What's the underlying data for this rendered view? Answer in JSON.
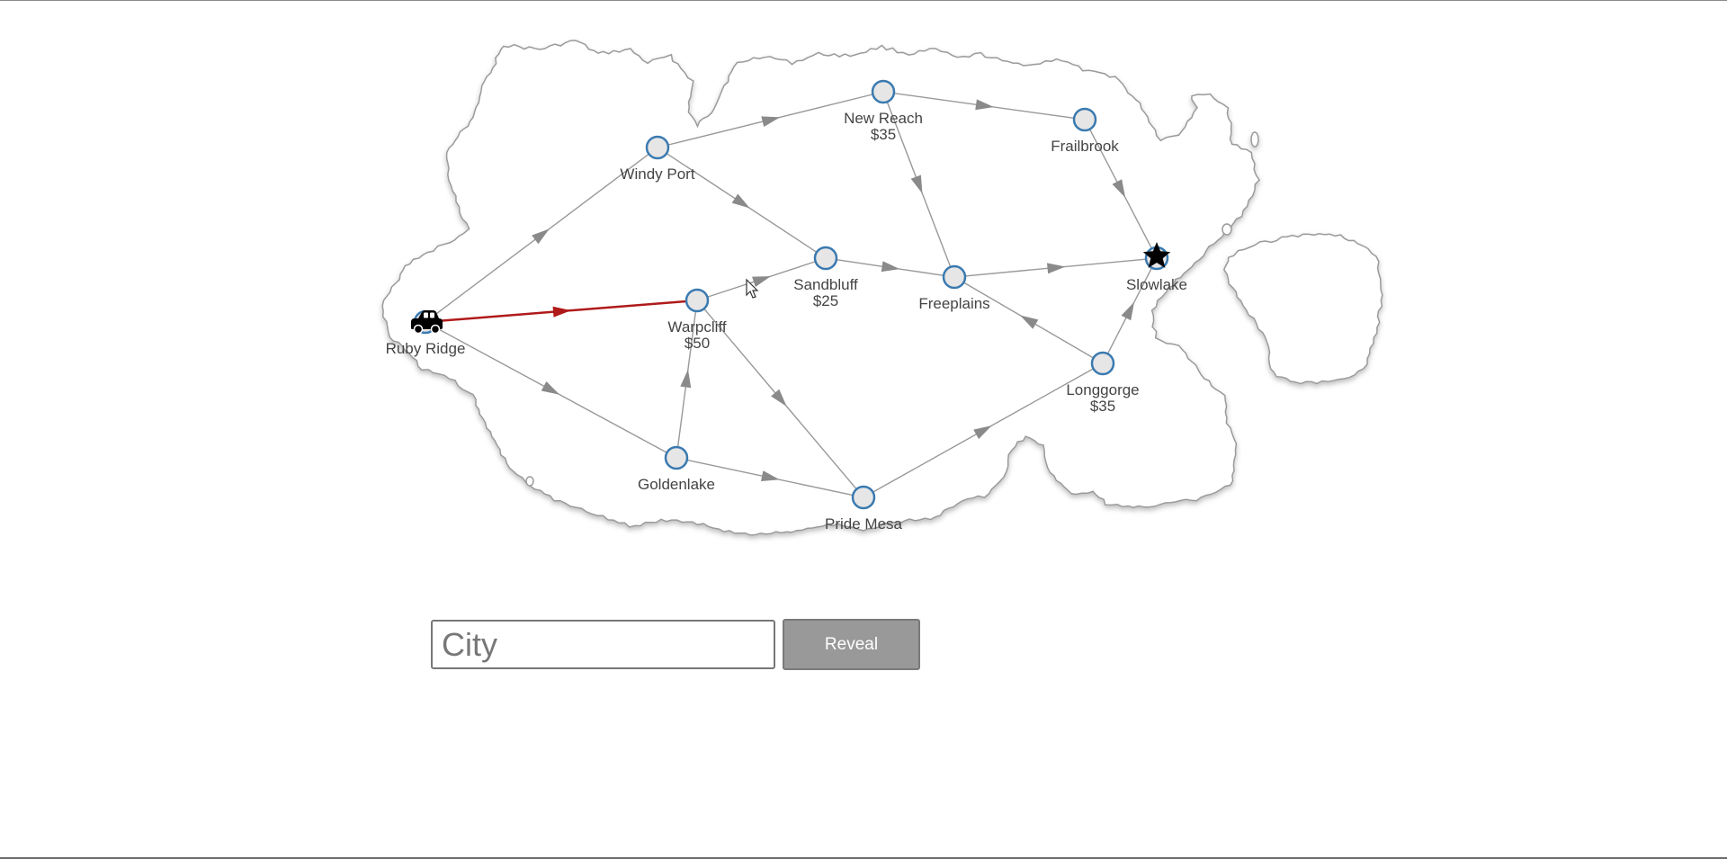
{
  "map": {
    "cities": [
      {
        "id": "ruby-ridge",
        "name": "Ruby Ridge",
        "cost": "",
        "marker": "car-icon"
      },
      {
        "id": "windy-port",
        "name": "Windy Port",
        "cost": ""
      },
      {
        "id": "new-reach",
        "name": "New Reach",
        "cost": "$35"
      },
      {
        "id": "frailbrook",
        "name": "Frailbrook",
        "cost": ""
      },
      {
        "id": "sandbluff",
        "name": "Sandbluff",
        "cost": "$25"
      },
      {
        "id": "warpcliff",
        "name": "Warpcliff",
        "cost": "$50"
      },
      {
        "id": "freeplains",
        "name": "Freeplains",
        "cost": ""
      },
      {
        "id": "slowlake",
        "name": "Slowlake",
        "cost": "",
        "marker": "star-icon"
      },
      {
        "id": "longgorge",
        "name": "Longgorge",
        "cost": "$35"
      },
      {
        "id": "goldenlake",
        "name": "Goldenlake",
        "cost": ""
      },
      {
        "id": "pride-mesa",
        "name": "Pride Mesa",
        "cost": ""
      }
    ],
    "roads": [
      {
        "from": "ruby-ridge",
        "to": "windy-port"
      },
      {
        "from": "ruby-ridge",
        "to": "warpcliff",
        "highlighted": true
      },
      {
        "from": "ruby-ridge",
        "to": "goldenlake"
      },
      {
        "from": "windy-port",
        "to": "new-reach"
      },
      {
        "from": "windy-port",
        "to": "sandbluff"
      },
      {
        "from": "new-reach",
        "to": "frailbrook"
      },
      {
        "from": "new-reach",
        "to": "freeplains"
      },
      {
        "from": "frailbrook",
        "to": "slowlake"
      },
      {
        "from": "warpcliff",
        "to": "sandbluff"
      },
      {
        "from": "sandbluff",
        "to": "freeplains"
      },
      {
        "from": "freeplains",
        "to": "slowlake"
      },
      {
        "from": "warpcliff",
        "to": "pride-mesa"
      },
      {
        "from": "goldenlake",
        "to": "warpcliff"
      },
      {
        "from": "goldenlake",
        "to": "pride-mesa"
      },
      {
        "from": "pride-mesa",
        "to": "longgorge"
      },
      {
        "from": "longgorge",
        "to": "freeplains"
      },
      {
        "from": "longgorge",
        "to": "slowlake"
      }
    ],
    "colors": {
      "road": "#999999",
      "arrow": "#8a8a8a",
      "highlighted_road": "#b01a1a",
      "node_fill": "#e6e6e6",
      "node_stroke": "#3a7ab0",
      "land_fill": "#ffffff",
      "land_stroke": "#9a9a9a"
    }
  },
  "search": {
    "placeholder": "City",
    "value": "",
    "button_label": "Reveal"
  }
}
